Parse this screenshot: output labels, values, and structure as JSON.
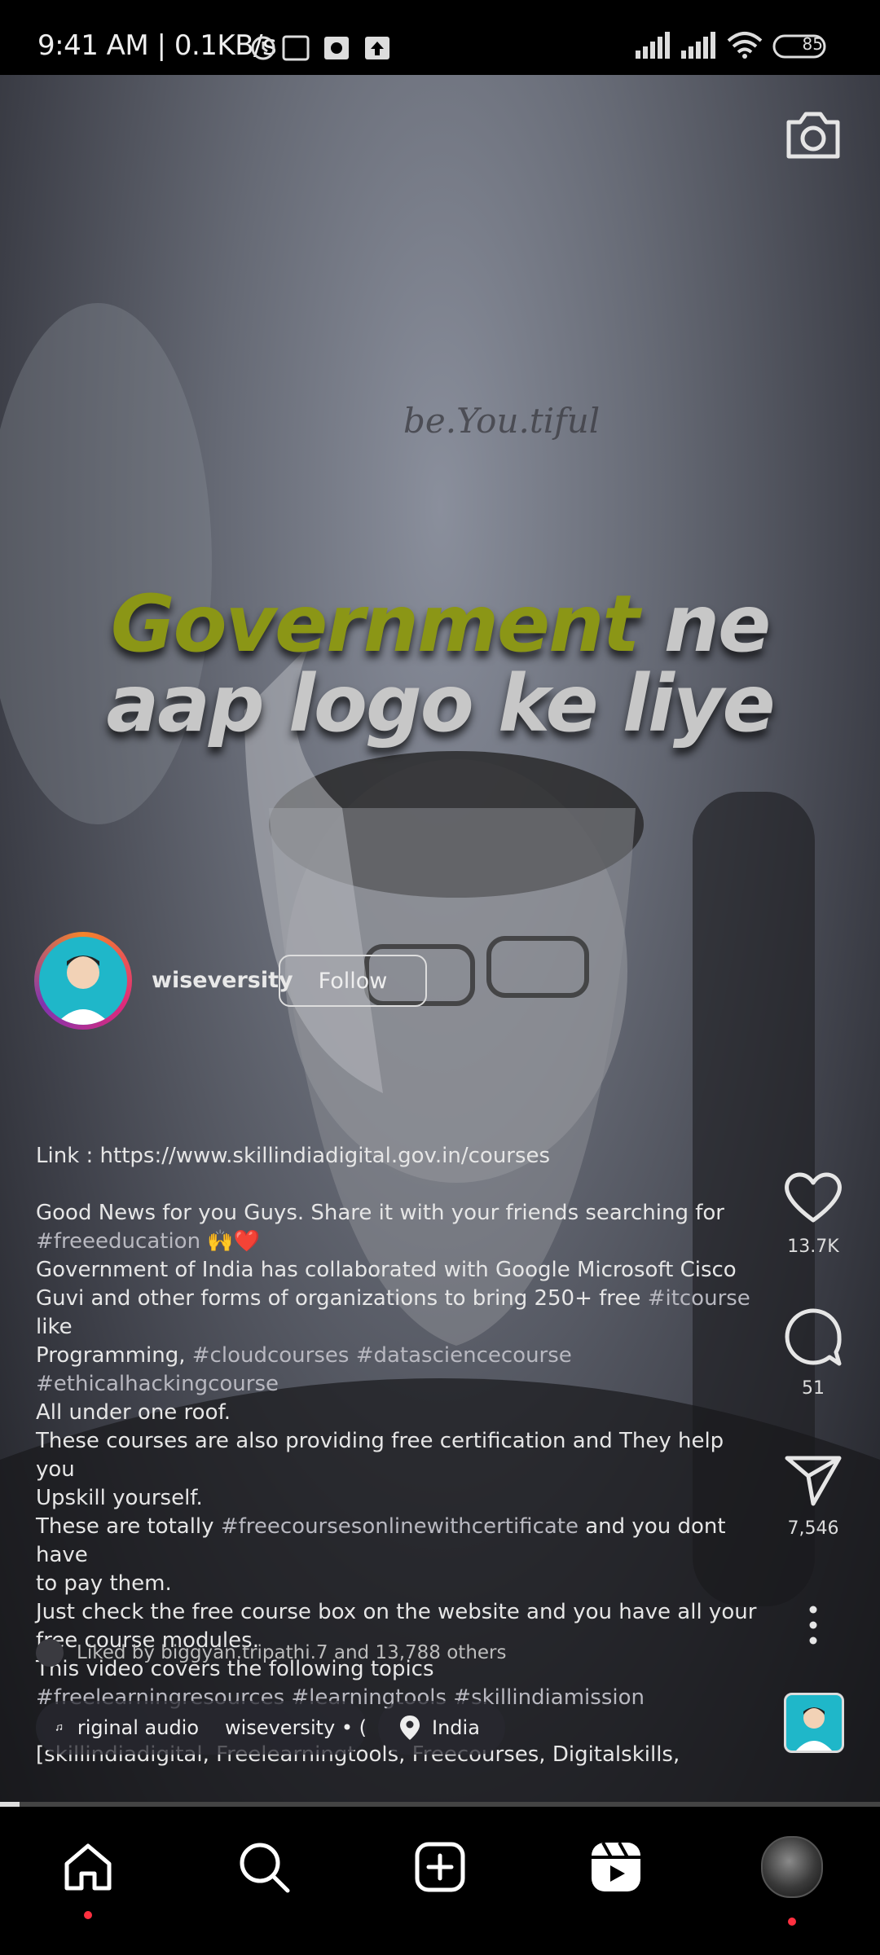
{
  "status_bar": {
    "time_speed": "9:41 AM | 0.1KB/s",
    "battery": "85",
    "icons": [
      "alarm-icon",
      "sim-icon",
      "notification-icon",
      "upload-icon",
      "signal-icon",
      "signal-icon",
      "wifi-icon",
      "battery-icon"
    ]
  },
  "video": {
    "watermark": "be.You.tiful",
    "headline_line1_accent": "Government",
    "headline_line1_rest": " ne",
    "headline_line2": "aap logo ke liye",
    "bottom_watermark": "wiseversity"
  },
  "author": {
    "username": "wiseversity",
    "follow_label": "Follow"
  },
  "caption": {
    "link": "Link : https://www.skillindiadigital.gov.in/courses",
    "line1": "Good News for you Guys. Share it with your friends searching for",
    "tag_freeeducation": "#freeeducation",
    "emoji": "🙌❤️",
    "line2": "Government of India has collaborated with Google Microsoft Cisco",
    "line3a": "Guvi and other forms of organizations to bring 250+ free ",
    "tag_itcourse": "#itcourse",
    "line3b": "  like",
    "line4a": "Programming, ",
    "tag_cloud": "#cloudcourses",
    "tag_datascience": "#datasciencecourse",
    "tag_ethical": "#ethicalhackingcourse",
    "line5": "All under one roof.",
    "line6": "These courses are also providing free certification and They help you",
    "line7": "Upskill yourself.",
    "line8a": "These are totally ",
    "tag_freecourses": "#freecoursesonlinewithcertificate",
    "line8b": " and you dont have",
    "line9": "to pay them.",
    "line10": "Just check the free course box on the website and you have all your",
    "line11": "free course modules.",
    "line12": "This video covers the following topics",
    "tag_freelearning": "#freelearningresources",
    "tag_learningtools": "#learningtools",
    "tag_skillindia": "#skillindiamission",
    "line13": "[skillindiadigital, Freelearningtools, Freecourses, Digitalskills,"
  },
  "liked_by": "Liked by biggyan.tripathi.7 and 13,788 others",
  "actions": {
    "likes": "13.7K",
    "comments": "51",
    "shares": "7,546"
  },
  "audio_chip": {
    "audio_label": "riginal audio",
    "author_label": "wiseversity • ("
  },
  "location_chip": {
    "label": "India"
  },
  "colors": {
    "accent_headline": "#8b9616",
    "notification_dot": "#ff3040",
    "avatar_bg": "#1fb7c9"
  },
  "nav": {
    "items": [
      "home-icon",
      "search-icon",
      "create-icon",
      "reels-icon",
      "profile-avatar"
    ]
  }
}
